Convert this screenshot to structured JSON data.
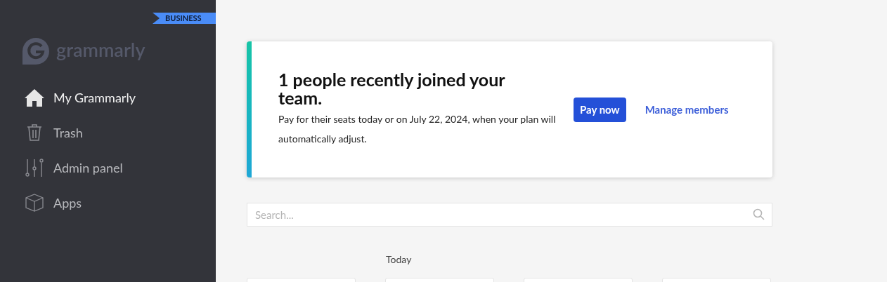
{
  "sidebar": {
    "badge": "BUSINESS",
    "logo": "grammarly",
    "items": [
      {
        "label": "My Grammarly",
        "kind": "home",
        "selected": true
      },
      {
        "label": "Trash",
        "kind": "trash",
        "selected": false
      },
      {
        "label": "Admin panel",
        "kind": "settings",
        "selected": false
      },
      {
        "label": "Apps",
        "kind": "apps",
        "selected": false
      }
    ]
  },
  "banner": {
    "title": "1 people recently joined your team.",
    "text": "Pay for their seats today or on July 22, 2024, when your plan will automatically adjust.",
    "primary_button": "Pay now",
    "link": "Manage members"
  },
  "search": {
    "placeholder": "Search..."
  },
  "documents": {
    "group_label": "Today"
  }
}
